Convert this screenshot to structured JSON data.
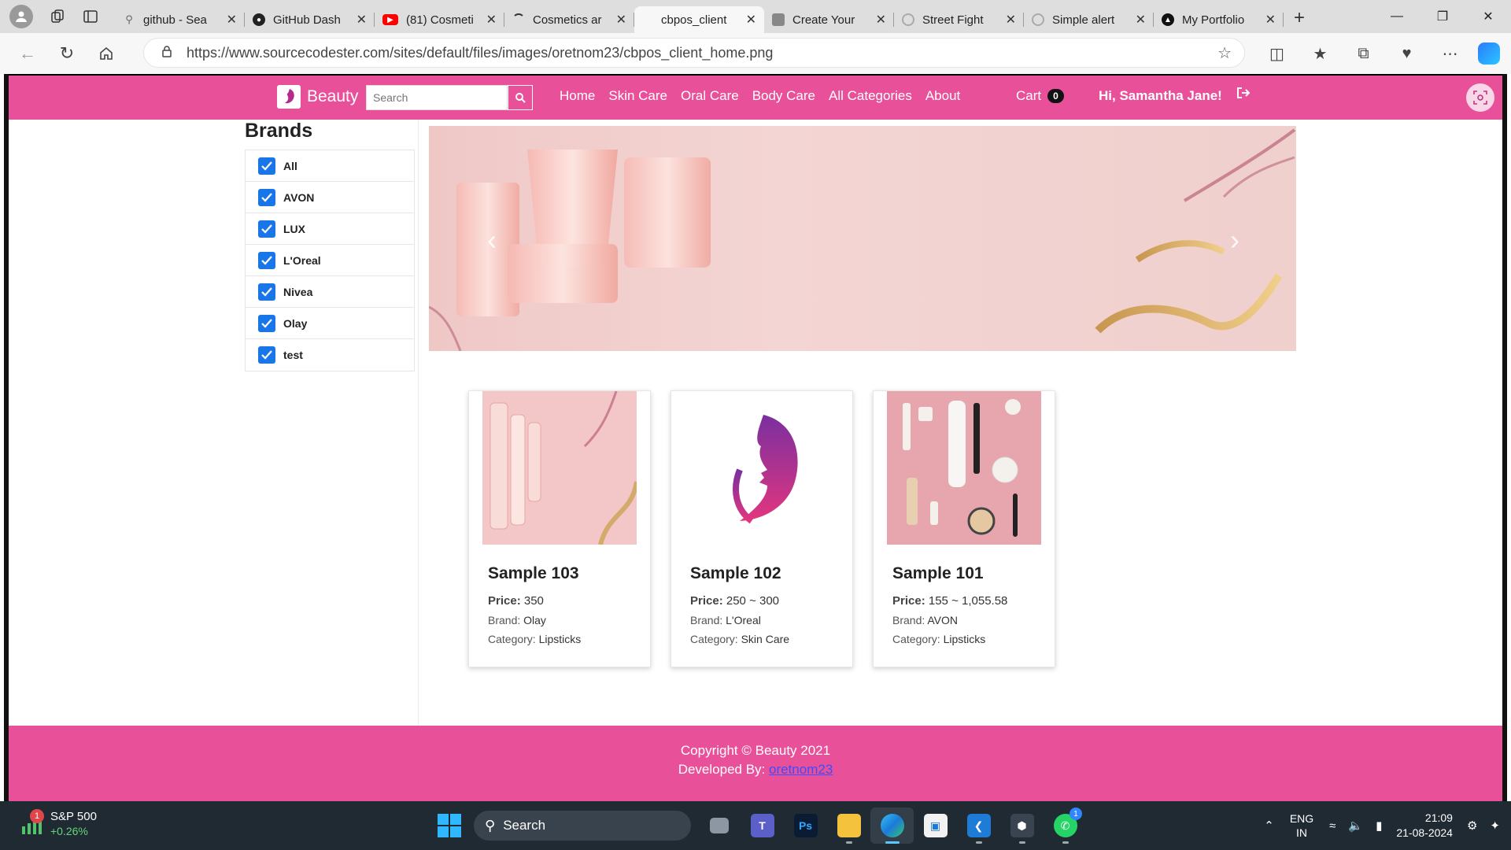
{
  "browser": {
    "tabs": [
      {
        "label": "github - Sea",
        "favicon": "search-icon",
        "active": false
      },
      {
        "label": "GitHub Dash",
        "favicon": "github-icon",
        "active": false
      },
      {
        "label": "(81) Cosmeti",
        "favicon": "youtube-icon",
        "active": false
      },
      {
        "label": "Cosmetics ar",
        "favicon": "loading-icon",
        "active": false
      },
      {
        "label": "cbpos_client",
        "favicon": "none",
        "active": true
      },
      {
        "label": "Create Your",
        "favicon": "page-icon",
        "active": false
      },
      {
        "label": "Street Fight",
        "favicon": "loading-icon",
        "active": false
      },
      {
        "label": "Simple alert",
        "favicon": "loading-icon",
        "active": false
      },
      {
        "label": "My Portfolio",
        "favicon": "portfolio-icon",
        "active": false
      }
    ],
    "url": "https://www.sourcecodester.com/sites/default/files/images/oretnom23/cbpos_client_home.png"
  },
  "site": {
    "brand": "Beauty",
    "search_placeholder": "Search",
    "menu": [
      "Home",
      "Skin Care",
      "Oral Care",
      "Body Care",
      "All Categories",
      "About"
    ],
    "cart_label": "Cart",
    "cart_count": "0",
    "greeting": "Hi, Samantha Jane!",
    "brands_title": "Brands",
    "brands": [
      "All",
      "AVON",
      "LUX",
      "L'Oreal",
      "Nivea",
      "Olay",
      "test"
    ],
    "products": [
      {
        "name": "Sample 103",
        "price_label": "Price:",
        "price": "350",
        "brand_label": "Brand:",
        "brand": "Olay",
        "category_label": "Category:",
        "category": "Lipsticks"
      },
      {
        "name": "Sample 102",
        "price_label": "Price:",
        "price": "250 ~ 300",
        "brand_label": "Brand:",
        "brand": "L'Oreal",
        "category_label": "Category:",
        "category": "Skin Care"
      },
      {
        "name": "Sample 101",
        "price_label": "Price:",
        "price": "155 ~ 1,055.58",
        "brand_label": "Brand:",
        "brand": "AVON",
        "category_label": "Category:",
        "category": "Lipsticks"
      }
    ],
    "footer": {
      "copyright": "Copyright © Beauty 2021",
      "developed_label": "Developed By:",
      "developer": "oretnom23"
    },
    "colors": {
      "primary": "#e9509a",
      "checkbox": "#1976e8"
    }
  },
  "taskbar": {
    "widget_title": "S&P 500",
    "widget_change": "+0.26%",
    "widget_badge": "1",
    "search_label": "Search",
    "whatsapp_badge": "1",
    "lang_top": "ENG",
    "lang_bottom": "IN",
    "time": "21:09",
    "date": "21-08-2024"
  }
}
